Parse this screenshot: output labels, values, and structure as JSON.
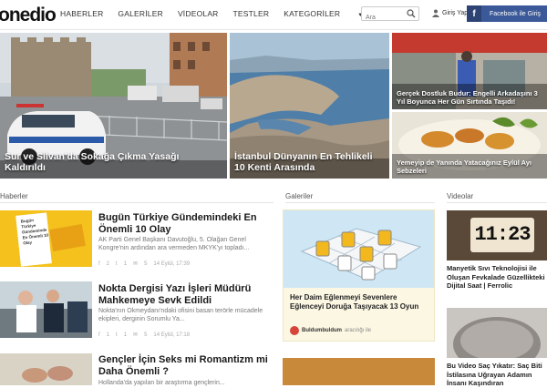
{
  "header": {
    "logo": "onedio",
    "menu": [
      "HABERLER",
      "GALERİLER",
      "VİDEOLAR",
      "TESTLER",
      "KATEGORİLER"
    ],
    "search_placeholder": "Ara",
    "login_label": "Giriş Yap",
    "facebook_label": "Facebook ile Giriş"
  },
  "heroes": [
    {
      "caption": "Sur ve Silvan'da Sokağa Çıkma Yasağı Kaldırıldı"
    },
    {
      "caption": "İstanbul Dünyanın En Tehlikeli 10 Kenti Arasında"
    },
    {
      "caption": "Gerçek Dostluk Budur: Engelli Arkadaşını 3 Yıl Boyunca Her Gün Sırtında Taşıdı!"
    },
    {
      "caption": "Yemeyip de Yanında Yatacağınız Eylül Ayı Sebzeleri"
    }
  ],
  "sections": {
    "news": "Haberler",
    "galleries": "Galeriler",
    "videos": "Videolar"
  },
  "news": [
    {
      "title": "Bugün Türkiye Gündemindeki En Önemli 10 Olay",
      "desc": "AK Parti Genel Başkanı Davutoğlu, 5. Olağan Genel Kongre'nin ardından ara vermeden MKYK'yı topladı...",
      "likes": "2",
      "shares": "1",
      "comments": "5",
      "date": "14 Eylül, 17:39",
      "thumb_text": "Bugün Türkiye Gündeminde En Önemli 10 Olay"
    },
    {
      "title": "Nokta Dergisi Yazı İşleri Müdürü Mahkemeye Sevk Edildi",
      "desc": "Nokta'nın Okmeydanı'ndaki ofisini basan terörle mücadele ekipleri, derginin Sorumlu Ya...",
      "likes": "1",
      "shares": "1",
      "comments": "5",
      "date": "14 Eylül, 17:18"
    },
    {
      "title": "Gençler İçin Seks mi Romantizm mi Daha Önemli ?",
      "desc": "Hollanda'da yapılan bir araştırma gençlerin..."
    }
  ],
  "gallery": {
    "title": "Her Daim Eğlenmeyi Sevenlere Eğlenceyi Doruğa Taşıyacak 13 Oyun",
    "author": "Buldumbuldum",
    "author_suffix": "aracılığı ile"
  },
  "videos": [
    {
      "title": "Manyetik Sıvı Teknolojisi ile Oluşan Fevkalade Güzellikteki Dijital Saat | Ferrolic",
      "clock": "11:23"
    },
    {
      "title": "Bu Video Saç Yıkatır: Saç Biti İstilasına Uğrayan Adamın İnsanı Kaşındıran"
    }
  ]
}
